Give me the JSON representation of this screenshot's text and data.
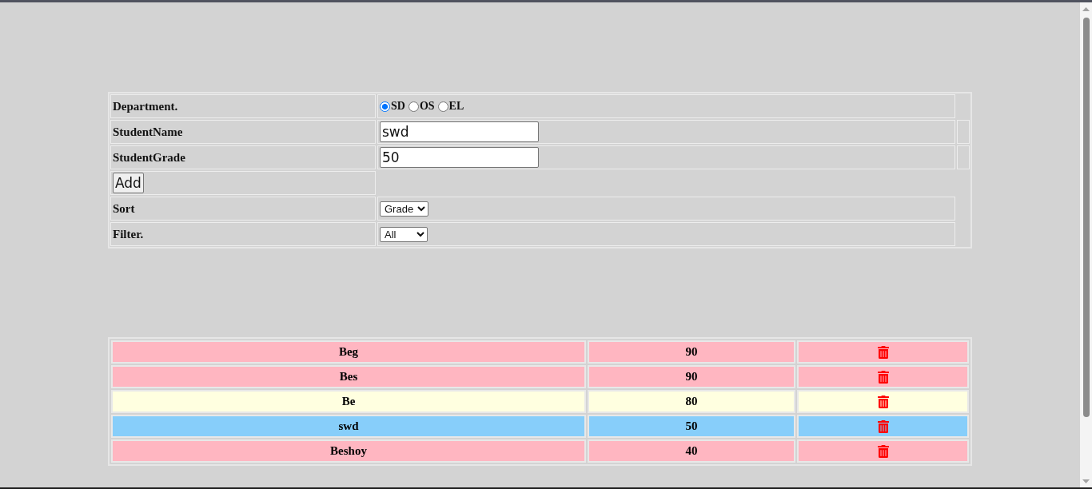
{
  "form": {
    "rows": [
      {
        "kind": "radio",
        "label": "Department.",
        "options": [
          {
            "label": "SD",
            "selected": true
          },
          {
            "label": "OS",
            "selected": false
          },
          {
            "label": "EL",
            "selected": false
          }
        ]
      },
      {
        "kind": "text",
        "label": "StudentName",
        "value": "swd"
      },
      {
        "kind": "text",
        "label": "StudentGrade",
        "value": "50"
      },
      {
        "kind": "button",
        "label": "Add"
      },
      {
        "kind": "select",
        "label": "Sort",
        "value": "Grade"
      },
      {
        "kind": "select",
        "label": "Filter.",
        "value": "All"
      }
    ]
  },
  "students": [
    {
      "name": "Beg",
      "grade": "90",
      "color": "#ffb6c1"
    },
    {
      "name": "Bes",
      "grade": "90",
      "color": "#ffb6c1"
    },
    {
      "name": "Be",
      "grade": "80",
      "color": "#ffffe0"
    },
    {
      "name": "swd",
      "grade": "50",
      "color": "#87cefa"
    },
    {
      "name": "Beshoy",
      "grade": "40",
      "color": "#ffb6c1"
    }
  ]
}
